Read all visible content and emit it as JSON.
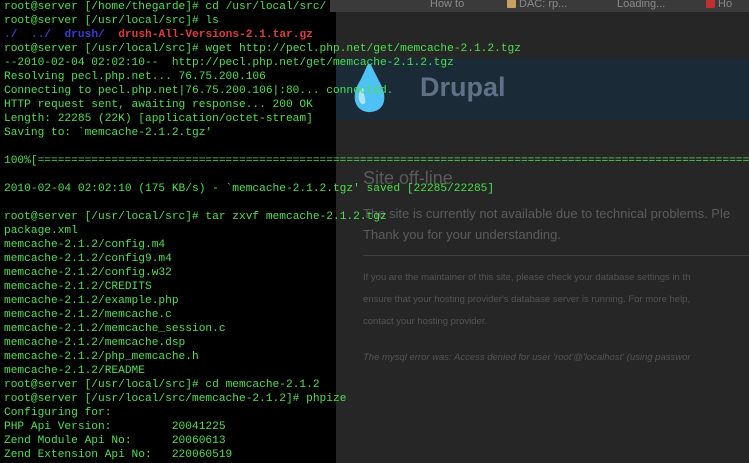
{
  "browser": {
    "tabs": [
      {
        "label": "How to",
        "favicon_color": "#8a8a8a"
      },
      {
        "label": "DAC: rp...",
        "favicon_color": "#c8a060"
      },
      {
        "label": "Loading...",
        "favicon_color": "#b0b0b0"
      },
      {
        "label": "Ho",
        "favicon_color": "#c03030"
      }
    ],
    "site_name": "Drupal",
    "logo_icon": "drupal-drop-icon",
    "page_title": "Site off-line",
    "message_1": "The site is currently not available due to technical problems. Ple",
    "message_2": "Thank you for your understanding.",
    "detail_1": "If you are the maintainer of this site, please check your database settings in th",
    "detail_2": "ensure that your hosting provider's database server is running. For more help,",
    "detail_3": "contact your hosting provider.",
    "error_prefix": "The mysql error was: ",
    "error_text": "Access denied for user 'root'@'localhost' (using passwor"
  },
  "terminal": {
    "prompt_home": "root@server [/home/thegarde]#",
    "cmd_cd_src": "cd /usr/local/src/",
    "prompt_src": "root@server [/usr/local/src]#",
    "cmd_ls": "ls",
    "ls_entries": [
      {
        "text": "./",
        "color": "blue"
      },
      {
        "text": "../",
        "color": "blue"
      },
      {
        "text": "drush/",
        "color": "blue"
      },
      {
        "text": "drush-All-Versions-2.1.tar.gz",
        "color": "red"
      }
    ],
    "cmd_wget": "wget http://pecl.php.net/get/memcache-2.1.2.tgz",
    "wget_output": [
      "--2010-02-04 02:02:10--  http://pecl.php.net/get/memcache-2.1.2.tgz",
      "Resolving pecl.php.net... 76.75.200.106",
      "Connecting to pecl.php.net|76.75.200.106|:80... connected.",
      "HTTP request sent, awaiting response... 200 OK",
      "Length: 22285 (22K) [application/octet-stream]",
      "Saving to: `memcache-2.1.2.tgz'"
    ],
    "progress_line": "100%[=====================================================================================================================================================",
    "saved_line": "2010-02-04 02:02:10 (175 KB/s) - `memcache-2.1.2.tgz' saved [22285/22285]",
    "cmd_tar": "tar zxvf memcache-2.1.2.tgz",
    "tar_output": [
      "package.xml",
      "memcache-2.1.2/config.m4",
      "memcache-2.1.2/config9.m4",
      "memcache-2.1.2/config.w32",
      "memcache-2.1.2/CREDITS",
      "memcache-2.1.2/example.php",
      "memcache-2.1.2/memcache.c",
      "memcache-2.1.2/memcache_session.c",
      "memcache-2.1.2/memcache.dsp",
      "memcache-2.1.2/php_memcache.h",
      "memcache-2.1.2/README"
    ],
    "cmd_cd_memcache": "cd memcache-2.1.2",
    "prompt_memcache": "root@server [/usr/local/src/memcache-2.1.2]#",
    "cmd_phpize": "phpize",
    "phpize_output": [
      "Configuring for:",
      "PHP Api Version:         20041225",
      "Zend Module Api No:      20060613",
      "Zend Extension Api No:   220060519"
    ]
  }
}
